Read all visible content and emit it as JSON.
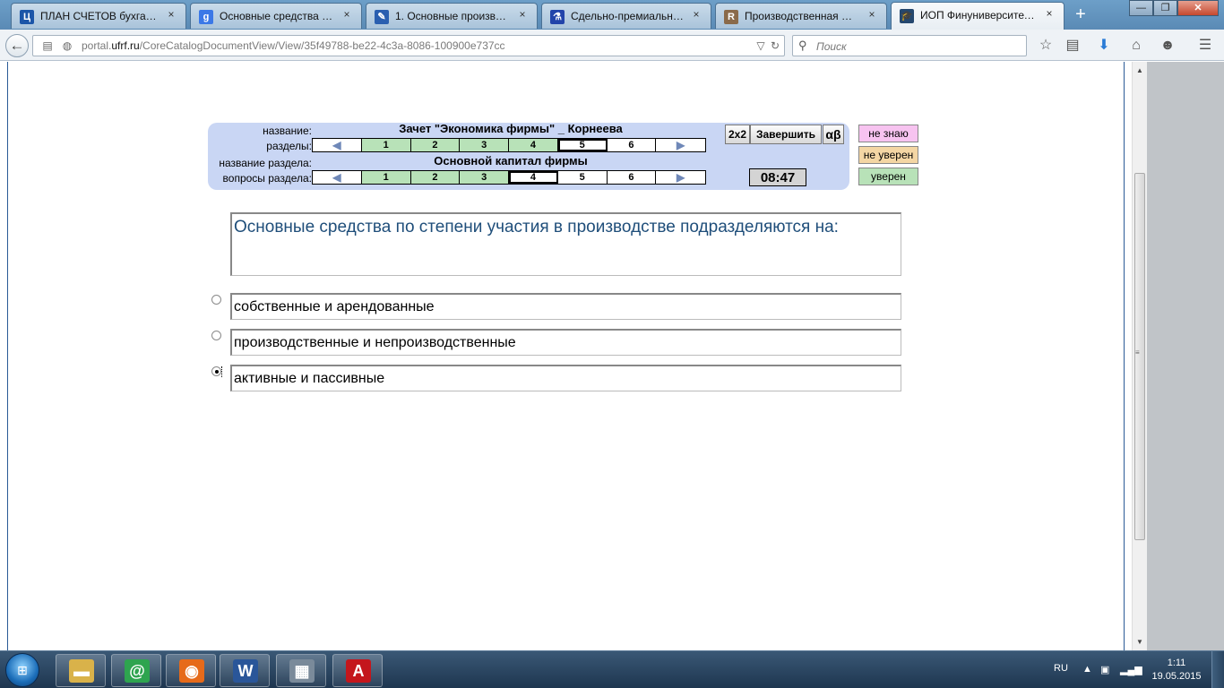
{
  "browser": {
    "tabs": [
      {
        "label": "ПЛАН СЧЕТОВ бухгалт...",
        "favicon": "Ц",
        "favicon_color": "#1b55a8",
        "active": false
      },
      {
        "label": "Основные средства по ...",
        "favicon": "g",
        "favicon_color": "#3b78e7",
        "active": false
      },
      {
        "label": "1.  Основные производ...",
        "favicon": "✎",
        "favicon_color": "#2a5fb0",
        "active": false
      },
      {
        "label": "Сдельно-премиальная...",
        "favicon": "⚗",
        "favicon_color": "#2244aa",
        "active": false
      },
      {
        "label": "Производственная мо...",
        "favicon": "R",
        "favicon_color": "#8a6a4a",
        "active": false
      },
      {
        "label": "ИОП Финуниверситета...",
        "favicon": "🎓",
        "favicon_color": "#24476e",
        "active": true
      }
    ],
    "tab_close": "×",
    "new_tab": "+",
    "window_buttons": {
      "minimize": "—",
      "maximize": "❐",
      "close": "✕"
    },
    "url_prefix": "portal.",
    "url_domain": "ufrf.ru",
    "url_path": "/CoreCatalogDocumentView/View/35f49788-be22-4c3a-8086-100900e737cc",
    "search_placeholder": "Поиск"
  },
  "panel": {
    "label_name": "название:",
    "label_sections": "разделы:",
    "label_section_name": "название раздела:",
    "label_questions": "вопросы раздела:",
    "test_title": "Зачет \"Экономика фирмы\" _ Корнеева",
    "section_title": "Основной капитал фирмы",
    "sections": [
      {
        "label": "1",
        "state": "done"
      },
      {
        "label": "2",
        "state": "done"
      },
      {
        "label": "3",
        "state": "done"
      },
      {
        "label": "4",
        "state": "done"
      },
      {
        "label": "5",
        "state": "current"
      },
      {
        "label": "6",
        "state": "todo"
      }
    ],
    "questions": [
      {
        "label": "1",
        "state": "done"
      },
      {
        "label": "2",
        "state": "done"
      },
      {
        "label": "3",
        "state": "done"
      },
      {
        "label": "4",
        "state": "current"
      },
      {
        "label": "5",
        "state": "todo"
      },
      {
        "label": "6",
        "state": "todo"
      }
    ],
    "arrow_prev": "◀",
    "arrow_next": "▶",
    "btn_2x2": "2x2",
    "btn_finish": "Завершить",
    "btn_alpha": "αβ",
    "timer": "08:47"
  },
  "confidence": {
    "dont_know": "не знаю",
    "dont_know_color": "#f7c3f0",
    "not_sure": "не уверен",
    "not_sure_color": "#f4d6a4",
    "sure": "уверен",
    "sure_color": "#b8e2b8"
  },
  "question": {
    "text": "Основные средства по степени участия в производстве подразделяются на:",
    "answers": [
      {
        "text": "собственные и арендованные",
        "selected": false
      },
      {
        "text": "производственные и непроизводственные",
        "selected": false
      },
      {
        "text": "активные и пассивные",
        "selected": true
      }
    ]
  },
  "taskbar": {
    "apps": [
      {
        "name": "explorer",
        "glyph": "▬",
        "color": "#d9b24a"
      },
      {
        "name": "mail-agent",
        "glyph": "@",
        "color": "#2ea44f"
      },
      {
        "name": "firefox",
        "glyph": "◉",
        "color": "#e66a1a"
      },
      {
        "name": "word",
        "glyph": "W",
        "color": "#2a5699"
      },
      {
        "name": "calculator",
        "glyph": "▦",
        "color": "#7a8a9a"
      },
      {
        "name": "acrobat",
        "glyph": "A",
        "color": "#c4161c"
      }
    ],
    "language": "RU",
    "time": "1:11",
    "date": "19.05.2015"
  }
}
